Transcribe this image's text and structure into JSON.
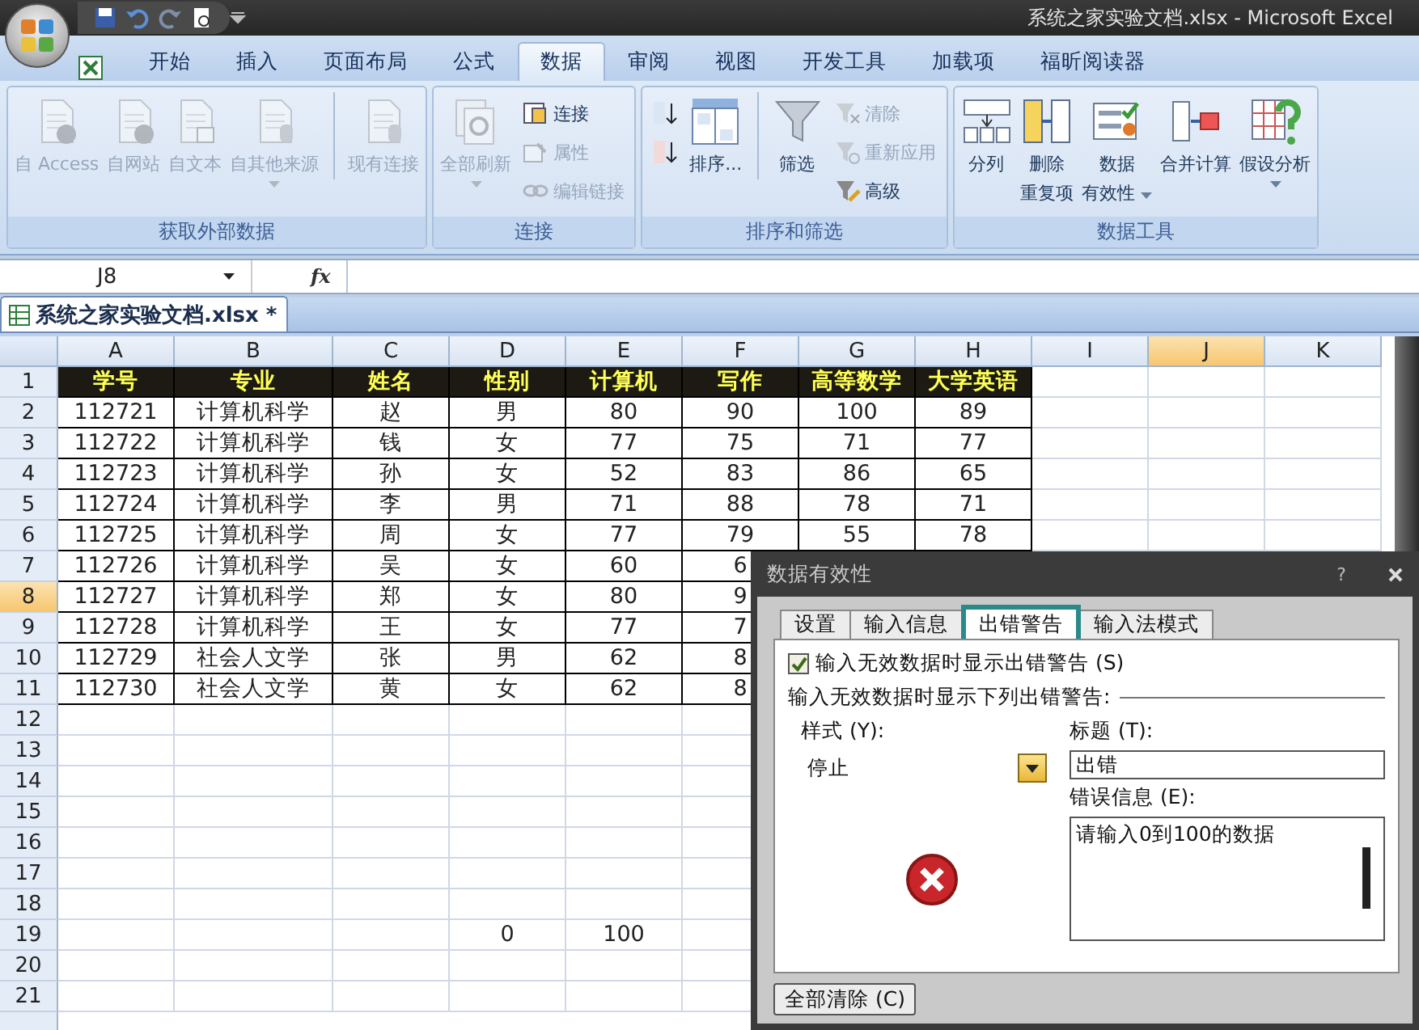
{
  "window": {
    "title": "系统之家实验文档.xlsx - Microsoft Excel"
  },
  "ribbon_tabs": [
    {
      "label": "开始",
      "selected": false
    },
    {
      "label": "插入",
      "selected": false
    },
    {
      "label": "页面布局",
      "selected": false
    },
    {
      "label": "公式",
      "selected": false
    },
    {
      "label": "数据",
      "selected": true
    },
    {
      "label": "审阅",
      "selected": false
    },
    {
      "label": "视图",
      "selected": false
    },
    {
      "label": "开发工具",
      "selected": false
    },
    {
      "label": "加载项",
      "selected": false
    },
    {
      "label": "福昕阅读器",
      "selected": false
    }
  ],
  "ribbon_groups": [
    {
      "title": "获取外部数据",
      "items": [
        {
          "kind": "large",
          "lines": [
            "自 Access"
          ],
          "disabled": true,
          "dropdown": false,
          "separator_before": false
        },
        {
          "kind": "large",
          "lines": [
            "自网站"
          ],
          "disabled": true,
          "dropdown": false,
          "separator_before": false
        },
        {
          "kind": "large",
          "lines": [
            "自文本"
          ],
          "disabled": true,
          "dropdown": false,
          "separator_before": false
        },
        {
          "kind": "large",
          "lines": [
            "自其他来源"
          ],
          "disabled": true,
          "dropdown": true,
          "separator_before": false
        },
        {
          "kind": "large",
          "lines": [
            "现有连接"
          ],
          "disabled": true,
          "dropdown": false,
          "separator_before": true
        }
      ]
    },
    {
      "title": "连接",
      "items": [
        {
          "kind": "large",
          "lines": [
            "全部刷新"
          ],
          "disabled": true,
          "dropdown": true,
          "separator_before": false
        },
        {
          "kind": "stack",
          "separator_before": false,
          "buttons": [
            {
              "label": "连接",
              "disabled": false
            },
            {
              "label": "属性",
              "disabled": true
            },
            {
              "label": "编辑链接",
              "disabled": true
            }
          ]
        }
      ]
    },
    {
      "title": "排序和筛选",
      "items": [
        {
          "kind": "stack",
          "separator_before": false,
          "buttons": [
            {
              "disabled": false
            },
            {
              "disabled": false
            }
          ]
        },
        {
          "kind": "large",
          "lines": [
            "排序..."
          ],
          "disabled": false,
          "dropdown": false,
          "separator_before": false
        },
        {
          "kind": "large",
          "lines": [
            "筛选"
          ],
          "disabled": false,
          "dropdown": false,
          "separator_before": true
        },
        {
          "kind": "stack",
          "separator_before": false,
          "buttons": [
            {
              "label": "清除",
              "disabled": true
            },
            {
              "label": "重新应用",
              "disabled": true
            },
            {
              "label": "高级",
              "disabled": false
            }
          ]
        }
      ]
    },
    {
      "title": "数据工具",
      "items": [
        {
          "kind": "large",
          "lines": [
            "分列"
          ],
          "disabled": false,
          "dropdown": false,
          "separator_before": false
        },
        {
          "kind": "large",
          "lines": [
            "删除",
            "重复项"
          ],
          "disabled": false,
          "dropdown": false,
          "separator_before": false
        },
        {
          "kind": "large",
          "lines": [
            "数据",
            "有效性"
          ],
          "disabled": false,
          "dropdown": true,
          "separator_before": false
        },
        {
          "kind": "large",
          "lines": [
            "合并计算"
          ],
          "disabled": false,
          "dropdown": false,
          "separator_before": false
        },
        {
          "kind": "large",
          "lines": [
            "假设分析"
          ],
          "disabled": false,
          "dropdown": true,
          "separator_before": false
        }
      ]
    }
  ],
  "formula_bar": {
    "name_box": "J8",
    "function_label": "fx"
  },
  "workbook_tab": {
    "title": "系统之家实验文档.xlsx *"
  },
  "sheet": {
    "columns": [
      {
        "label": "A",
        "selected": false
      },
      {
        "label": "B",
        "selected": false
      },
      {
        "label": "C",
        "selected": false
      },
      {
        "label": "D",
        "selected": false
      },
      {
        "label": "E",
        "selected": false
      },
      {
        "label": "F",
        "selected": false
      },
      {
        "label": "G",
        "selected": false
      },
      {
        "label": "H",
        "selected": false
      },
      {
        "label": "I",
        "selected": false
      },
      {
        "label": "J",
        "selected": true
      },
      {
        "label": "K",
        "selected": false
      }
    ],
    "rows": [
      {
        "number": "1",
        "selected": false,
        "kind": "header",
        "cells": [
          "学号",
          "专业",
          "姓名",
          "性别",
          "计算机",
          "写作",
          "高等数学",
          "大学英语"
        ]
      },
      {
        "number": "2",
        "selected": false,
        "kind": "data",
        "cells": [
          "112721",
          "计算机科学",
          "赵",
          "男",
          "80",
          "90",
          "100",
          "89"
        ]
      },
      {
        "number": "3",
        "selected": false,
        "kind": "data",
        "cells": [
          "112722",
          "计算机科学",
          "钱",
          "女",
          "77",
          "75",
          "71",
          "77"
        ]
      },
      {
        "number": "4",
        "selected": false,
        "kind": "data",
        "cells": [
          "112723",
          "计算机科学",
          "孙",
          "女",
          "52",
          "83",
          "86",
          "65"
        ]
      },
      {
        "number": "5",
        "selected": false,
        "kind": "data",
        "cells": [
          "112724",
          "计算机科学",
          "李",
          "男",
          "71",
          "88",
          "78",
          "71"
        ]
      },
      {
        "number": "6",
        "selected": false,
        "kind": "data",
        "cells": [
          "112725",
          "计算机科学",
          "周",
          "女",
          "77",
          "79",
          "55",
          "78"
        ]
      },
      {
        "number": "7",
        "selected": false,
        "kind": "data",
        "cells": [
          "112726",
          "计算机科学",
          "吴",
          "女",
          "60",
          "6"
        ]
      },
      {
        "number": "8",
        "selected": true,
        "kind": "data",
        "cells": [
          "112727",
          "计算机科学",
          "郑",
          "女",
          "80",
          "9"
        ]
      },
      {
        "number": "9",
        "selected": false,
        "kind": "data",
        "cells": [
          "112728",
          "计算机科学",
          "王",
          "女",
          "77",
          "7"
        ]
      },
      {
        "number": "10",
        "selected": false,
        "kind": "data",
        "cells": [
          "112729",
          "社会人文学",
          "张",
          "男",
          "62",
          "8"
        ]
      },
      {
        "number": "11",
        "selected": false,
        "kind": "data",
        "cells": [
          "112730",
          "社会人文学",
          "黄",
          "女",
          "62",
          "8"
        ]
      },
      {
        "number": "12",
        "selected": false,
        "kind": "blank"
      },
      {
        "number": "13",
        "selected": false,
        "kind": "blank"
      },
      {
        "number": "14",
        "selected": false,
        "kind": "blank"
      },
      {
        "number": "15",
        "selected": false,
        "kind": "blank"
      },
      {
        "number": "16",
        "selected": false,
        "kind": "blank"
      },
      {
        "number": "17",
        "selected": false,
        "kind": "blank"
      },
      {
        "number": "18",
        "selected": false,
        "kind": "blank"
      },
      {
        "number": "19",
        "selected": false,
        "kind": "plain",
        "cells": [
          null,
          null,
          null,
          "0",
          "100"
        ]
      },
      {
        "number": "20",
        "selected": false,
        "kind": "blank"
      },
      {
        "number": "21",
        "selected": false,
        "kind": "blank"
      }
    ]
  },
  "dialog": {
    "title": "数据有效性",
    "help": "?",
    "tabs": [
      {
        "label": "设置",
        "selected": false
      },
      {
        "label": "输入信息",
        "selected": false
      },
      {
        "label": "出错警告",
        "selected": true
      },
      {
        "label": "输入法模式",
        "selected": false
      }
    ],
    "show_alert": {
      "label": "输入无效数据时显示出错警告 (S)",
      "checked": true
    },
    "section_label": "输入无效数据时显示下列出错警告:",
    "style": {
      "label": "样式 (Y):",
      "value": "停止"
    },
    "alert_title": {
      "label": "标题 (T):",
      "value": "出错"
    },
    "message": {
      "label": "错误信息 (E):",
      "value": "请输入0到100的数据"
    },
    "clear_button": "全部清除 (C)"
  }
}
